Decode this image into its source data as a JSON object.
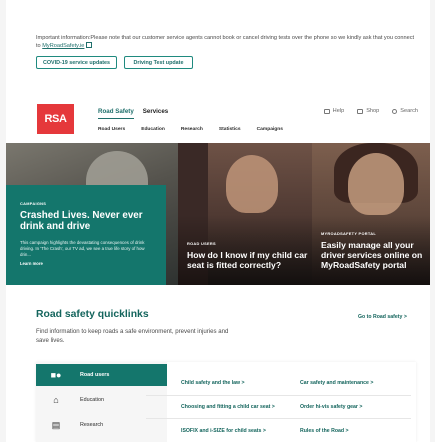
{
  "notice": {
    "text": "Important information:Please note that our customer service agents cannot book or cancel driving tests over the phone so we kindly ask that you connect to ",
    "link": "MyRoadSafety.ie",
    "buttons": [
      "COVID-19 service updates",
      "Driving Test update"
    ]
  },
  "header": {
    "logo": "RSA",
    "main_nav": [
      "Road Safety",
      "Services"
    ],
    "sub_nav": [
      "Road Users",
      "Education",
      "Research",
      "Statistics",
      "Campaigns"
    ],
    "utilities": [
      "Help",
      "Shop",
      "Search"
    ]
  },
  "hero": {
    "campaign": {
      "kicker": "CAMPAIGNS",
      "title": "Crashed Lives. Never ever drink and drive",
      "text": "This campaign highlights the devastating consequences of drink driving. In 'The Crash', our TV ad, we see a true life story of how drin...",
      "more": "Learn more"
    },
    "tile2": {
      "kicker": "ROAD USERS",
      "title": "How do I know if my child car seat is fitted correctly?"
    },
    "tile3": {
      "kicker": "MYROADSAFETY PORTAL",
      "title": "Easily manage all your driver services online on MyRoadSafety portal"
    }
  },
  "quicklinks": {
    "title": "Road safety quicklinks",
    "go_link": "Go to Road safety",
    "description": "Find information to keep roads a safe environment, prevent injuries and save lives.",
    "sidebar": [
      {
        "label": "Road users",
        "icon": "car-icon",
        "active": true
      },
      {
        "label": "Education",
        "icon": "building-icon",
        "active": false
      },
      {
        "label": "Research",
        "icon": "document-icon",
        "active": false
      }
    ],
    "links": [
      "Child safety and the law",
      "Car safety and maintenance",
      "Choosing and fitting a child car seat",
      "Order hi-vis safety gear",
      "ISOFIX and i-SIZE for child seats",
      "Rules of the Road"
    ]
  },
  "colors": {
    "brand_teal": "#14766c",
    "logo_red": "#e5383b"
  }
}
